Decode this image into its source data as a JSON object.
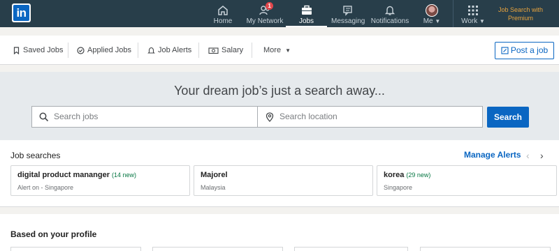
{
  "topnav": {
    "logo_text": "in",
    "items": [
      {
        "label": "Home",
        "icon": "home-icon"
      },
      {
        "label": "My Network",
        "icon": "network-icon",
        "badge": "1"
      },
      {
        "label": "Jobs",
        "icon": "briefcase-icon",
        "active": true
      },
      {
        "label": "Messaging",
        "icon": "messaging-icon"
      },
      {
        "label": "Notifications",
        "icon": "bell-icon"
      },
      {
        "label": "Me",
        "icon": "avatar"
      },
      {
        "label": "Work",
        "icon": "grid-icon"
      }
    ],
    "premium_label": "Job Search with Premium"
  },
  "subnav": {
    "items": [
      {
        "label": "Saved Jobs",
        "icon": "bookmark-icon"
      },
      {
        "label": "Applied Jobs",
        "icon": "check-circle-icon"
      },
      {
        "label": "Job Alerts",
        "icon": "bell-icon"
      },
      {
        "label": "Salary",
        "icon": "money-icon"
      },
      {
        "label": "More",
        "icon": "chevron-down-icon"
      }
    ],
    "post_job_label": "Post a job"
  },
  "hero": {
    "title": "Your dream job’s just a search away...",
    "search_jobs_placeholder": "Search jobs",
    "search_location_placeholder": "Search location",
    "search_button": "Search"
  },
  "job_searches": {
    "title": "Job searches",
    "manage_alerts": "Manage Alerts",
    "prev": "‹",
    "next": "›",
    "cards": [
      {
        "title": "digital product mananger",
        "new": "(14 new)",
        "subtitle": "Alert on - Singapore"
      },
      {
        "title": "Majorel",
        "new": "",
        "subtitle": "Malaysia"
      },
      {
        "title": "korea",
        "new": "(29 new)",
        "subtitle": "Singapore"
      }
    ]
  },
  "profile": {
    "title": "Based on your profile"
  },
  "colors": {
    "nav_bg": "#283e4a",
    "brand_blue": "#0a66c2",
    "premium_gold": "#e7a33e",
    "new_green": "#057642",
    "hero_bg": "#e6eaed",
    "badge_red": "#e0474c"
  }
}
